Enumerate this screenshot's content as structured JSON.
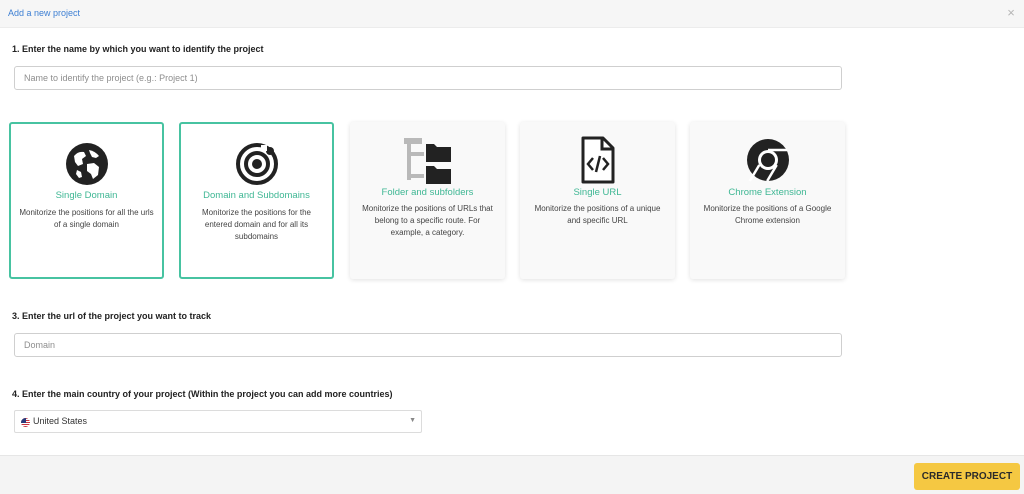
{
  "header": {
    "title": "Add a new project",
    "close_icon": "close-icon",
    "close_glyph": "×"
  },
  "step1": {
    "label": "1. Enter the name by which you want to identify the project",
    "placeholder": "Name to identify the project (e.g.: Project 1)",
    "value": ""
  },
  "project_types": [
    {
      "title": "Single Domain",
      "description": "Monitorize the positions for all the urls of a single domain",
      "icon": "globe-icon",
      "selected": true
    },
    {
      "title": "Domain and Subdomains",
      "description": "Monitorize the positions for the entered domain and for all its subdomains",
      "icon": "orbit-icon",
      "selected": true
    },
    {
      "title": "Folder and subfolders",
      "description": "Monitorize the positions of URLs that belong to a specific route. For example, a category.",
      "icon": "folder-tree-icon",
      "selected": false
    },
    {
      "title": "Single URL",
      "description": "Monitorize the positions of a unique and specific URL",
      "icon": "file-code-icon",
      "selected": false
    },
    {
      "title": "Chrome Extension",
      "description": "Monitorize the positions of a Google Chrome extension",
      "icon": "chrome-icon",
      "selected": false
    }
  ],
  "step3": {
    "label": "3. Enter the url of the project you want to track",
    "placeholder": "Domain",
    "value": ""
  },
  "step4": {
    "label": "4. Enter the main country of your project (Within the project you can add more countries)",
    "selected_country": "United States",
    "flag_icon": "us-flag-icon",
    "caret_glyph": "▼"
  },
  "footer": {
    "create_label": "CREATE PROJECT"
  },
  "colors": {
    "accent": "#47c3a1",
    "card_title": "#3fb794",
    "header_link": "#3d7fd3",
    "button": "#f5c842",
    "icon": "#222222"
  }
}
